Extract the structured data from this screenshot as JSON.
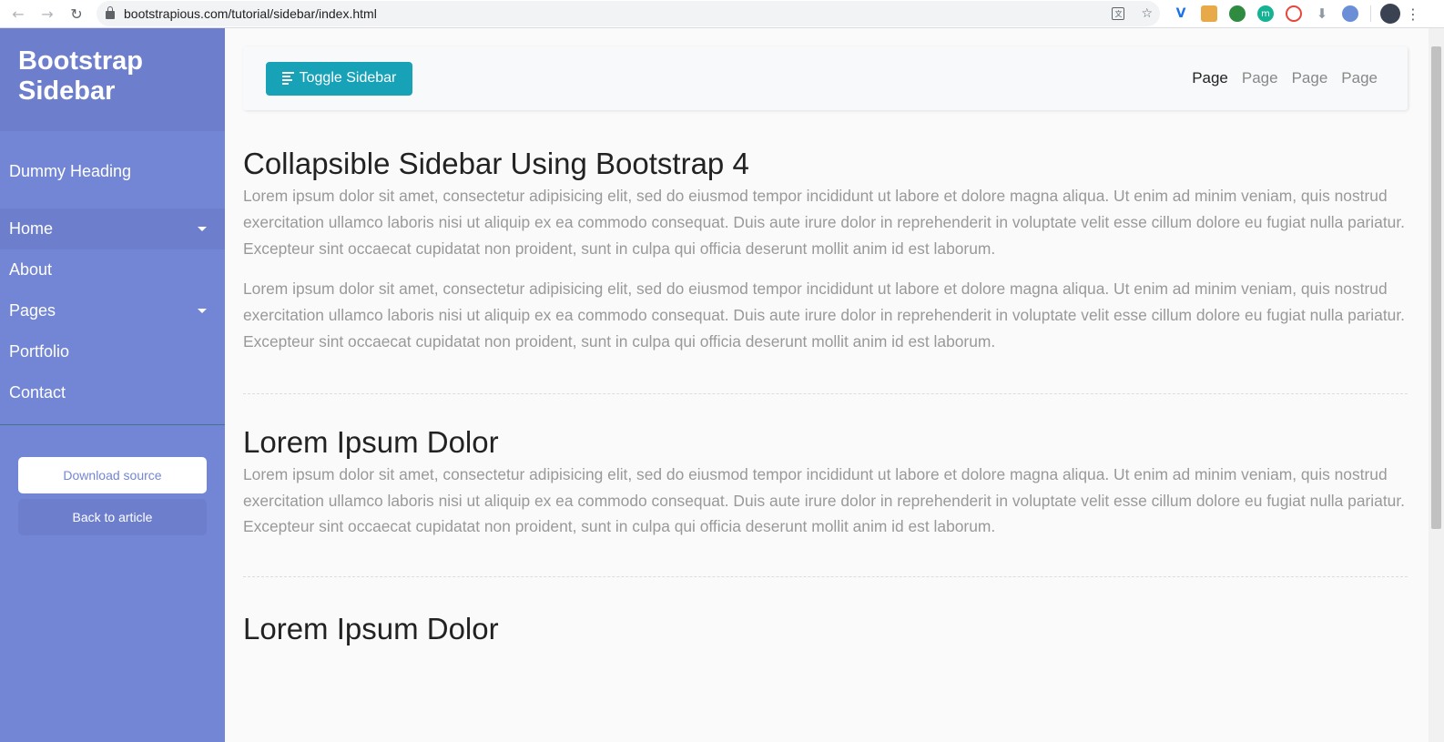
{
  "browser": {
    "url": "bootstrapious.com/tutorial/sidebar/index.html",
    "icons": [
      "back-icon",
      "forward-icon",
      "reload-icon",
      "lock-icon",
      "translate-icon",
      "star-icon",
      "profile-icon",
      "menu-icon"
    ]
  },
  "sidebar": {
    "brand": "Bootstrap Sidebar",
    "heading": "Dummy Heading",
    "items": [
      {
        "label": "Home"
      },
      {
        "label": "About"
      },
      {
        "label": "Pages"
      },
      {
        "label": "Portfolio"
      },
      {
        "label": "Contact"
      }
    ],
    "download_label": "Download source",
    "article_label": "Back to article"
  },
  "navbar": {
    "toggle_label": "Toggle Sidebar",
    "links": [
      "Page",
      "Page",
      "Page",
      "Page"
    ]
  },
  "main": {
    "title1": "Collapsible Sidebar Using Bootstrap 4",
    "p1": "Lorem ipsum dolor sit amet, consectetur adipisicing elit, sed do eiusmod tempor incididunt ut labore et dolore magna aliqua. Ut enim ad minim veniam, quis nostrud exercitation ullamco laboris nisi ut aliquip ex ea commodo consequat. Duis aute irure dolor in reprehenderit in voluptate velit esse cillum dolore eu fugiat nulla pariatur. Excepteur sint occaecat cupidatat non proident, sunt in culpa qui officia deserunt mollit anim id est laborum.",
    "p2": "Lorem ipsum dolor sit amet, consectetur adipisicing elit, sed do eiusmod tempor incididunt ut labore et dolore magna aliqua. Ut enim ad minim veniam, quis nostrud exercitation ullamco laboris nisi ut aliquip ex ea commodo consequat. Duis aute irure dolor in reprehenderit in voluptate velit esse cillum dolore eu fugiat nulla pariatur. Excepteur sint occaecat cupidatat non proident, sunt in culpa qui officia deserunt mollit anim id est laborum.",
    "title2": "Lorem Ipsum Dolor",
    "p3": "Lorem ipsum dolor sit amet, consectetur adipisicing elit, sed do eiusmod tempor incididunt ut labore et dolore magna aliqua. Ut enim ad minim veniam, quis nostrud exercitation ullamco laboris nisi ut aliquip ex ea commodo consequat. Duis aute irure dolor in reprehenderit in voluptate velit esse cillum dolore eu fugiat nulla pariatur. Excepteur sint occaecat cupidatat non proident, sunt in culpa qui officia deserunt mollit anim id est laborum.",
    "title3": "Lorem Ipsum Dolor"
  },
  "colors": {
    "sidebar": "#7386d5",
    "sidebar_header": "#6d7fcc",
    "toggle": "#17a2b8"
  }
}
